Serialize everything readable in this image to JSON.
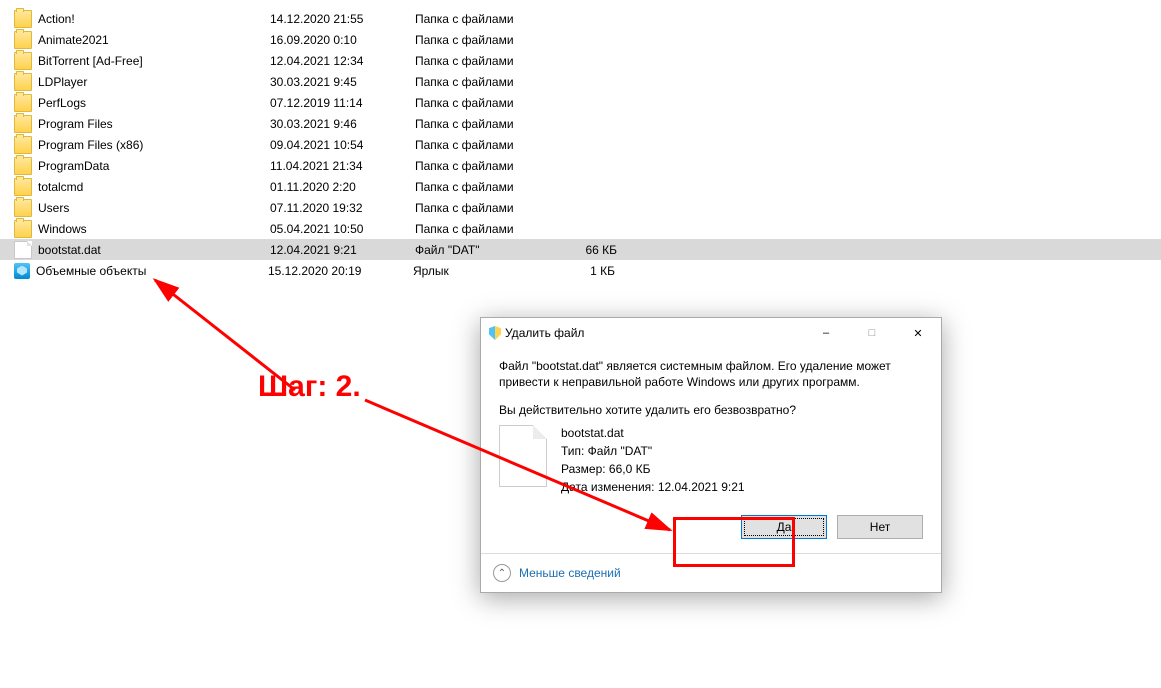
{
  "files": [
    {
      "icon": "folder",
      "name": "Action!",
      "date": "14.12.2020 21:55",
      "type": "Папка с файлами",
      "size": ""
    },
    {
      "icon": "folder",
      "name": "Animate2021",
      "date": "16.09.2020 0:10",
      "type": "Папка с файлами",
      "size": ""
    },
    {
      "icon": "folder",
      "name": "BitTorrent [Ad-Free]",
      "date": "12.04.2021 12:34",
      "type": "Папка с файлами",
      "size": ""
    },
    {
      "icon": "folder",
      "name": "LDPlayer",
      "date": "30.03.2021 9:45",
      "type": "Папка с файлами",
      "size": ""
    },
    {
      "icon": "folder",
      "name": "PerfLogs",
      "date": "07.12.2019 11:14",
      "type": "Папка с файлами",
      "size": ""
    },
    {
      "icon": "folder",
      "name": "Program Files",
      "date": "30.03.2021 9:46",
      "type": "Папка с файлами",
      "size": ""
    },
    {
      "icon": "folder",
      "name": "Program Files (x86)",
      "date": "09.04.2021 10:54",
      "type": "Папка с файлами",
      "size": ""
    },
    {
      "icon": "folder",
      "name": "ProgramData",
      "date": "11.04.2021 21:34",
      "type": "Папка с файлами",
      "size": ""
    },
    {
      "icon": "folder",
      "name": "totalcmd",
      "date": "01.11.2020 2:20",
      "type": "Папка с файлами",
      "size": ""
    },
    {
      "icon": "folder",
      "name": "Users",
      "date": "07.11.2020 19:32",
      "type": "Папка с файлами",
      "size": ""
    },
    {
      "icon": "folder",
      "name": "Windows",
      "date": "05.04.2021 10:50",
      "type": "Папка с файлами",
      "size": ""
    },
    {
      "icon": "file",
      "name": "bootstat.dat",
      "date": "12.04.2021 9:21",
      "type": "Файл \"DAT\"",
      "size": "66 КБ",
      "selected": true
    },
    {
      "icon": "3d",
      "name": "Объемные объекты",
      "date": "15.12.2020 20:19",
      "type": "Ярлык",
      "size": "1 КБ"
    }
  ],
  "dialog": {
    "title": "Удалить файл",
    "warning": "Файл \"bootstat.dat\" является системным файлом. Его удаление может привести к неправильной работе Windows или других программ.",
    "confirm": "Вы действительно хотите удалить его безвозвратно?",
    "filename": "bootstat.dat",
    "type_line": "Тип: Файл \"DAT\"",
    "size_line": "Размер: 66,0 КБ",
    "date_line": "Дата изменения: 12.04.2021 9:21",
    "yes": "Да",
    "no": "Нет",
    "less_info": "Меньше сведений"
  },
  "annotation": {
    "step": "Шаг: 2."
  }
}
